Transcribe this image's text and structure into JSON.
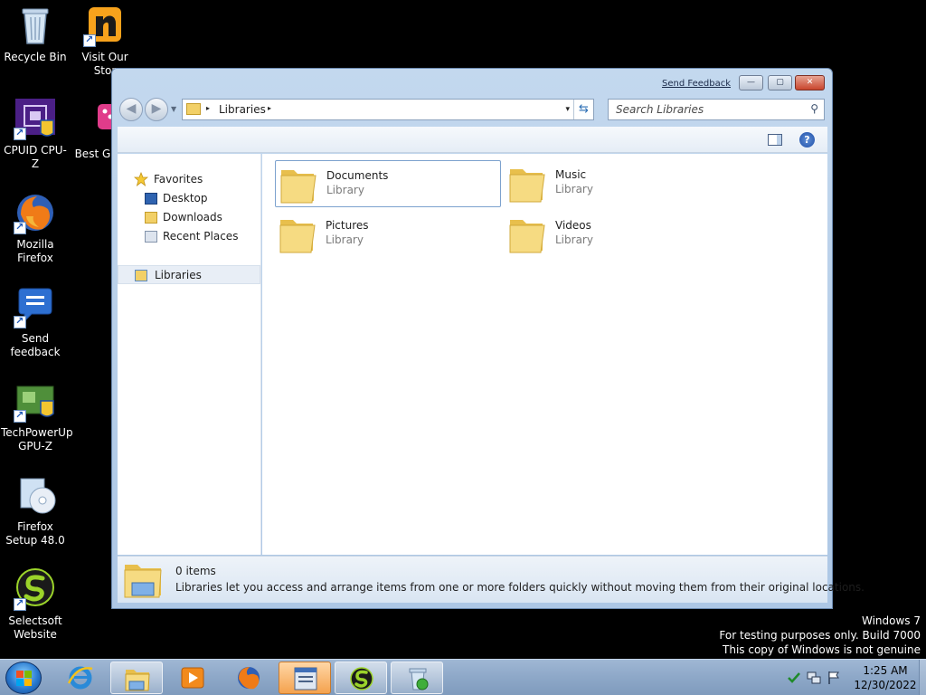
{
  "desktop": {
    "icons": [
      {
        "label": "Recycle Bin"
      },
      {
        "label": "Visit Our Stor"
      },
      {
        "label": "CPUID CPU-Z"
      },
      {
        "label": "Best G Hits"
      },
      {
        "label": "Mozilla Firefox"
      },
      {
        "label": "Send feedback"
      },
      {
        "label": "TechPowerUp GPU-Z"
      },
      {
        "label": "Firefox Setup 48.0"
      },
      {
        "label": "Selectsoft Website"
      }
    ]
  },
  "window": {
    "send_feedback": "Send Feedback",
    "caption": {
      "minimize": "—",
      "maximize": "▢",
      "close": "✕"
    },
    "address": {
      "path": "Libraries",
      "chevron": "▸",
      "dropdown": "▾",
      "refresh": "⇆"
    },
    "search": {
      "placeholder": "Search Libraries",
      "icon": "⚲"
    },
    "toolbar": {
      "help": "?"
    },
    "nav": {
      "favorites": "Favorites",
      "desktop": "Desktop",
      "downloads": "Downloads",
      "recent_places": "Recent Places",
      "libraries": "Libraries"
    },
    "libraries": [
      {
        "name": "Documents",
        "type": "Library"
      },
      {
        "name": "Music",
        "type": "Library"
      },
      {
        "name": "Pictures",
        "type": "Library"
      },
      {
        "name": "Videos",
        "type": "Library"
      }
    ],
    "details": {
      "count": "0 items",
      "description": "Libraries let you access and arrange items from one or more folders quickly without moving them from their original locations."
    }
  },
  "watermark": {
    "line1": "Windows 7",
    "line2": "For testing purposes only. Build 7000",
    "line3": "This copy of Windows is not genuine"
  },
  "taskbar": {
    "time": "1:25 AM",
    "date": "12/30/2022"
  },
  "colors": {
    "accent": "#2a7bd1",
    "window_frame": "#c3d8ee",
    "folder": "#f2d067"
  }
}
